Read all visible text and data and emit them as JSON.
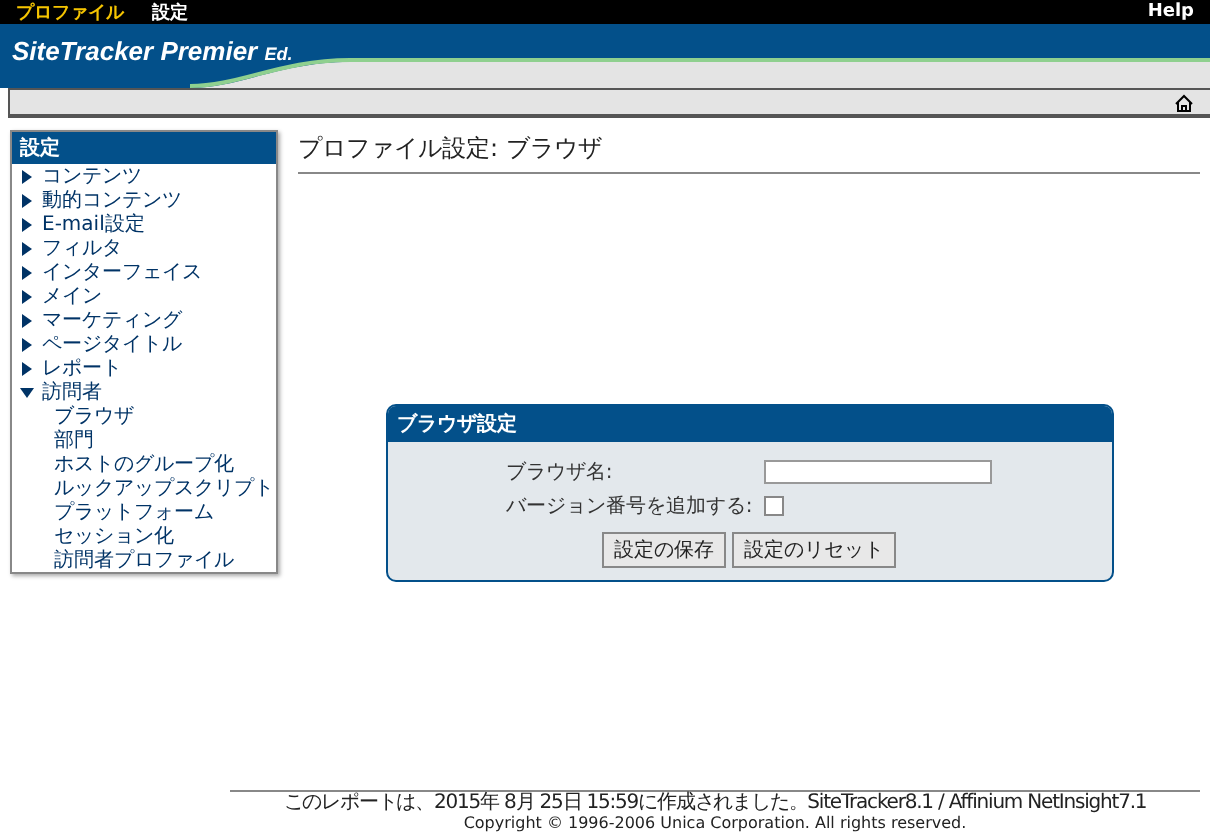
{
  "top_menu": {
    "items": [
      {
        "label": "プロファイル",
        "selected": true
      },
      {
        "label": "設定",
        "selected": false
      }
    ],
    "help": "Help"
  },
  "header": {
    "logo": "SiteTracker Premier",
    "logo_suffix": "Ed."
  },
  "sidebar": {
    "title": "設定",
    "items": [
      {
        "label": "コンテンツ",
        "expanded": false
      },
      {
        "label": "動的コンテンツ",
        "expanded": false
      },
      {
        "label": "E-mail設定",
        "expanded": false
      },
      {
        "label": "フィルタ",
        "expanded": false
      },
      {
        "label": "インターフェイス",
        "expanded": false
      },
      {
        "label": "メイン",
        "expanded": false
      },
      {
        "label": "マーケティング",
        "expanded": false
      },
      {
        "label": "ページタイトル",
        "expanded": false
      },
      {
        "label": "レポート",
        "expanded": false
      },
      {
        "label": "訪問者",
        "expanded": true,
        "children": [
          {
            "label": "ブラウザ"
          },
          {
            "label": "部門"
          },
          {
            "label": "ホストのグループ化"
          },
          {
            "label": "ルックアップスクリプト"
          },
          {
            "label": "プラットフォーム"
          },
          {
            "label": "セッション化"
          },
          {
            "label": "訪問者プロファイル"
          }
        ]
      }
    ]
  },
  "page_title": "プロファイル設定: ブラウザ",
  "panel": {
    "title": "ブラウザ設定",
    "fields": [
      {
        "kind": "text",
        "label": "ブラウザ名:"
      },
      {
        "kind": "checkbox",
        "label": "バージョン番号を追加する:",
        "checked": false
      }
    ],
    "buttons": [
      "設定の保存",
      "設定のリセット"
    ]
  },
  "footer": {
    "lines": [
      "このレポートは、2015年 8月 25日 15:59に作成されました。SiteTracker8.1 / Affinium NetInsight7.1",
      "Copyright © 1996-2006 Unica Corporation. All rights reserved."
    ]
  }
}
